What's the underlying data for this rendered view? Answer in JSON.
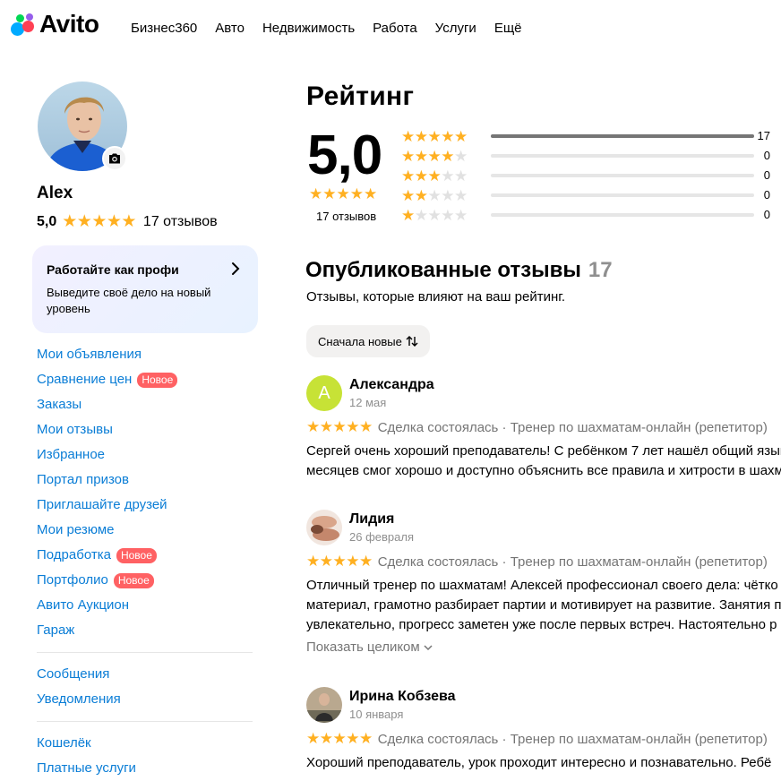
{
  "header": {
    "logo_text": "Avito",
    "nav": [
      "Бизнес360",
      "Авто",
      "Недвижимость",
      "Работа",
      "Услуги",
      "Ещё"
    ]
  },
  "profile": {
    "name": "Alex",
    "rating": "5,0",
    "stars": "★★★★★",
    "reviews_count_label": "17 отзывов"
  },
  "promo": {
    "title": "Работайте как профи",
    "text": "Выведите своё дело на новый уровень"
  },
  "menu": {
    "group1": [
      {
        "label": "Мои объявления",
        "badge": ""
      },
      {
        "label": "Сравнение цен",
        "badge": "Новое"
      },
      {
        "label": "Заказы",
        "badge": ""
      },
      {
        "label": "Мои отзывы",
        "badge": ""
      },
      {
        "label": "Избранное",
        "badge": ""
      },
      {
        "label": "Портал призов",
        "badge": ""
      },
      {
        "label": "Приглашайте друзей",
        "badge": ""
      },
      {
        "label": "Мои резюме",
        "badge": ""
      },
      {
        "label": "Подработка",
        "badge": "Новое"
      },
      {
        "label": "Портфолио",
        "badge": "Новое"
      },
      {
        "label": "Авито Аукцион",
        "badge": ""
      },
      {
        "label": "Гараж",
        "badge": ""
      }
    ],
    "group2": [
      {
        "label": "Сообщения"
      },
      {
        "label": "Уведомления"
      }
    ],
    "group3": [
      {
        "label": "Кошелёк"
      },
      {
        "label": "Платные услуги"
      }
    ]
  },
  "rating": {
    "title": "Рейтинг",
    "score": "5,0",
    "stars": "★★★★★",
    "count_label": "17 отзывов",
    "distribution": [
      {
        "stars": 5,
        "count": 17,
        "fraction": 1.0
      },
      {
        "stars": 4,
        "count": 0,
        "fraction": 0
      },
      {
        "stars": 3,
        "count": 0,
        "fraction": 0
      },
      {
        "stars": 2,
        "count": 0,
        "fraction": 0
      },
      {
        "stars": 1,
        "count": 0,
        "fraction": 0
      }
    ]
  },
  "reviews": {
    "title": "Опубликованные отзывы",
    "count": "17",
    "subtitle": "Отзывы, которые влияют на ваш рейтинг.",
    "sort_label": "Сначала новые",
    "items": [
      {
        "name": "Александра",
        "avatar_letter": "А",
        "date": "12 мая",
        "stars": "★★★★★",
        "meta": "Сделка состоялась · Тренер по шахматам-онлайн (репетитор)",
        "text": [
          "Сергей очень хороший преподаватель! С ребёнком 7 лет нашёл общий язык",
          "месяцев смог хорошо и доступно объяснить все правила и хитрости в шахм"
        ]
      },
      {
        "name": "Лидия",
        "avatar_letter": "",
        "date": "26 февраля",
        "stars": "★★★★★",
        "meta": "Сделка состоялась · Тренер по шахматам-онлайн (репетитор)",
        "text": [
          "Отличный тренер по шахматам! Алексей профессионал своего дела: чётко",
          "материал, грамотно разбирает партии и мотивирует на развитие. Занятия п",
          "увлекательно, прогресс заметен уже после первых встреч. Настоятельно р"
        ],
        "show_more": "Показать целиком"
      },
      {
        "name": "Ирина Кобзева",
        "avatar_letter": "",
        "date": "10 января",
        "stars": "★★★★★",
        "meta": "Сделка состоялась · Тренер по шахматам-онлайн (репетитор)",
        "text": [
          "Хороший преподаватель, урок проходит интересно и познавательно. Ребё"
        ]
      }
    ]
  }
}
